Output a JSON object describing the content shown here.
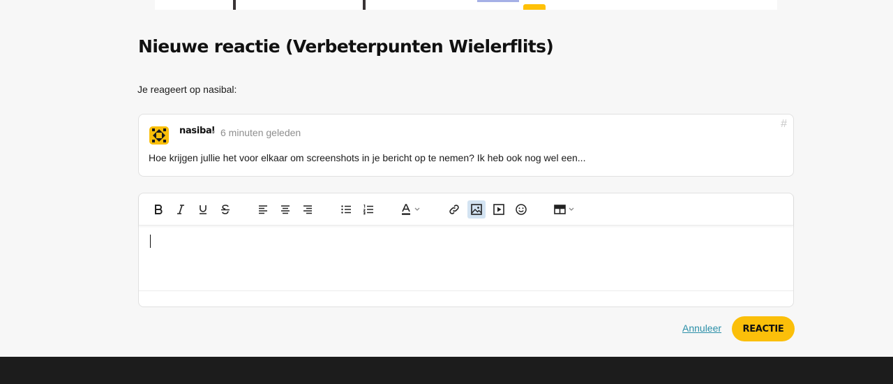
{
  "page": {
    "title": "Nieuwe reactie (Verbeterpunten Wielerflits)",
    "reply_label": "Je reageert op nasibal:"
  },
  "quote": {
    "author": "nasibal",
    "separator": "•",
    "timestamp": "6 minuten geleden",
    "anchor": "#",
    "text": "Hoe krijgen jullie het voor elkaar om screenshots in je bericht op te nemen? Ik heb ook nog wel een..."
  },
  "toolbar": {
    "buttons": [
      "bold-icon",
      "italic-icon",
      "underline-icon",
      "strikethrough-icon",
      "align-left-icon",
      "align-center-icon",
      "align-right-icon",
      "bullet-list-icon",
      "numbered-list-icon",
      "text-color-icon",
      "link-icon",
      "image-icon",
      "video-icon",
      "emoji-icon",
      "table-icon"
    ],
    "active": "image-icon"
  },
  "actions": {
    "cancel_label": "Annuleer",
    "submit_label": "REACTIE"
  },
  "colors": {
    "accent": "#fbbf0a",
    "link": "#2a8fa8",
    "footer": "#1c1c1c",
    "active_tool": "#d3e3f2"
  }
}
